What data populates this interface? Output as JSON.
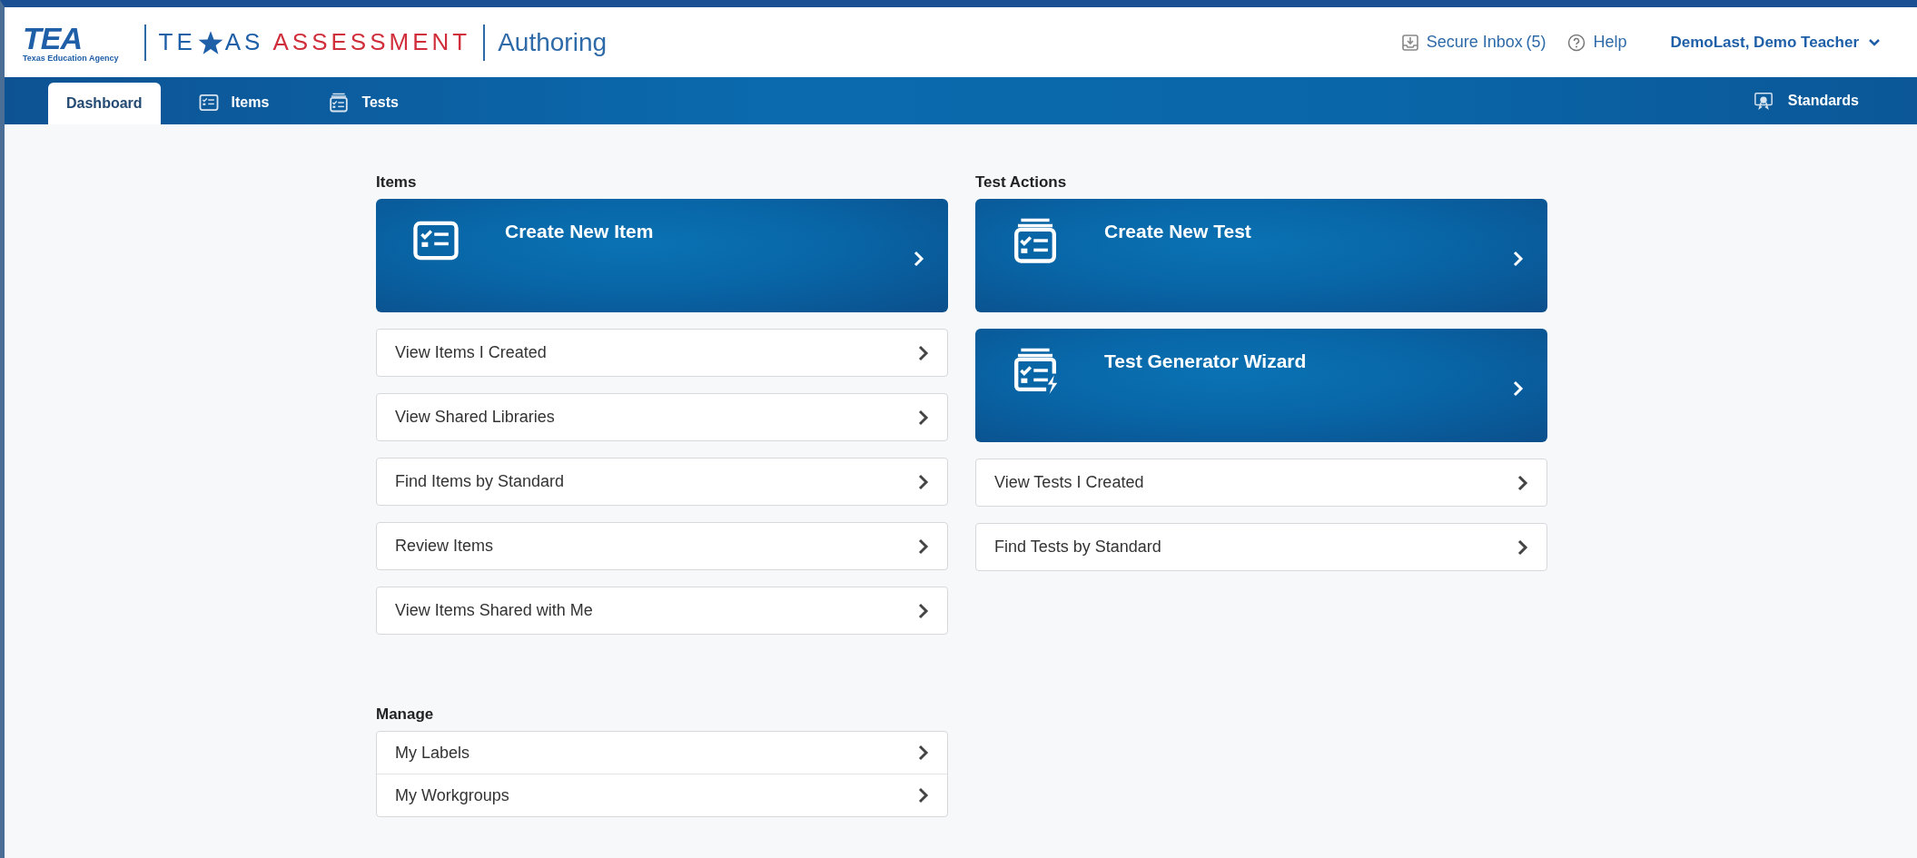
{
  "header": {
    "logo": {
      "mark": "TEA",
      "tagline": "Texas Education Agency"
    },
    "brand": {
      "part_1": "TE",
      "part_2": "AS",
      "part_3": "ASSESSMENT"
    },
    "app_name": "Authoring",
    "links": [
      {
        "kind": "inbox",
        "label": "Secure Inbox",
        "count": "(5)"
      },
      {
        "kind": "help",
        "label": "Help"
      }
    ],
    "user": {
      "name": "DemoLast, Demo Teacher"
    }
  },
  "nav": {
    "tabs": [
      {
        "label": "Dashboard",
        "selected": true
      },
      {
        "label": "Items",
        "selected": false
      },
      {
        "label": "Tests",
        "selected": false
      }
    ],
    "right": {
      "label": "Standards"
    }
  },
  "sections": [
    {
      "title": "Items",
      "actions": [
        {
          "kind": "item",
          "label": "Create New Item"
        },
        {
          "kind": "link",
          "label": "View Items I Created"
        },
        {
          "kind": "link",
          "label": "View Shared Libraries"
        },
        {
          "kind": "link",
          "label": "Find Items by Standard"
        },
        {
          "kind": "link",
          "label": "Review Items"
        },
        {
          "kind": "link",
          "label": "View Items Shared with Me"
        }
      ]
    },
    {
      "title": "Test Actions",
      "actions": [
        {
          "kind": "test",
          "label": "Create New Test"
        },
        {
          "kind": "wizard",
          "label": "Test Generator Wizard"
        },
        {
          "kind": "link",
          "label": "View Tests I Created"
        },
        {
          "kind": "link",
          "label": "Find Tests by Standard"
        }
      ]
    }
  ],
  "manage": {
    "title": "Manage",
    "items": [
      {
        "label": "My Labels"
      },
      {
        "label": "My Workgroups"
      }
    ]
  }
}
